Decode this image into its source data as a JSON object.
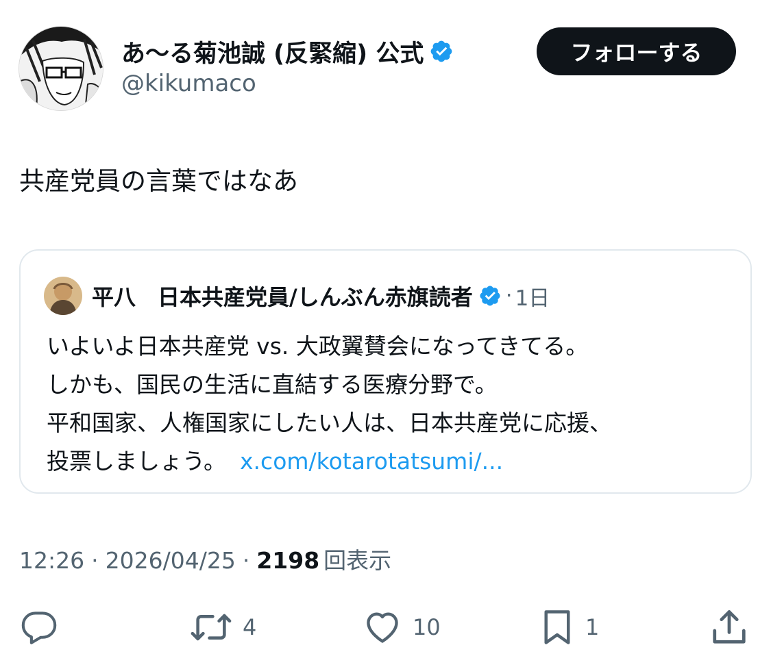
{
  "author": {
    "display_name": "あ〜る菊池誠 (反緊縮) 公式",
    "handle": "@kikumaco",
    "verified": true,
    "follow_label": "フォローする"
  },
  "tweet": {
    "text": "共産党員の言葉ではなあ"
  },
  "quote": {
    "display_name": "平八　日本共産党員/しんぶん赤旗読者",
    "verified": true,
    "separator": "·",
    "time": "1日",
    "lines": [
      "いよいよ日本共産党 vs. 大政翼賛会になってきてる。",
      "しかも、国民の生活に直結する医療分野で。",
      "平和国家、人権国家にしたい人は、日本共産党に応援、",
      "投票しましょう。"
    ],
    "link": "x.com/kotarotatsumi/..."
  },
  "meta": {
    "time": "12:26",
    "sep1": "·",
    "date": "2026/04/25",
    "sep2": "·",
    "views_count": "2198",
    "views_label": "回表示"
  },
  "actions": {
    "reply_icon": "reply-icon",
    "retweet_count": "4",
    "like_count": "10",
    "bookmark_count": "1",
    "share_icon": "share-icon"
  },
  "colors": {
    "text_primary": "#0f1419",
    "text_secondary": "#536471",
    "link": "#1d9bf0",
    "verified": "#1d9bf0",
    "button_bg": "#0f1419",
    "border": "#e1e8ed"
  }
}
